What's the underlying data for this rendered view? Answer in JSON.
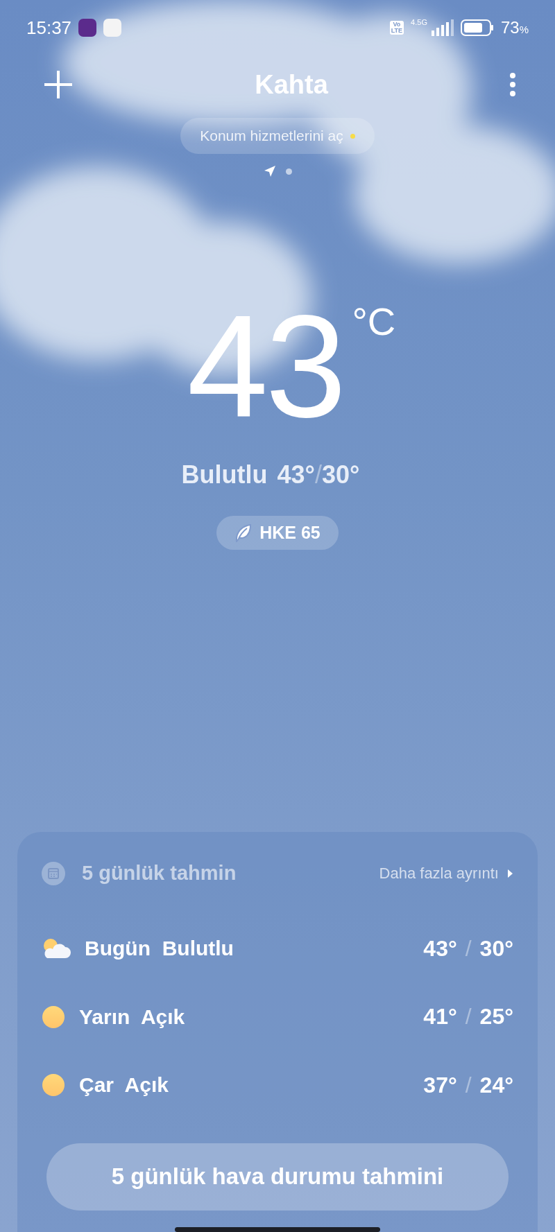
{
  "status_bar": {
    "time": "15:37",
    "volte_top": "Vo",
    "volte_bottom": "LTE",
    "network": "4.5G",
    "battery": "73",
    "battery_unit": "%"
  },
  "header": {
    "city": "Kahta",
    "location_prompt": "Konum hizmetlerini aç",
    "pages": [
      {
        "kind": "location",
        "selected": true
      },
      {
        "kind": "dot",
        "selected": false
      }
    ]
  },
  "current": {
    "temperature": "43",
    "unit": "°C",
    "condition": "Bulutlu",
    "high": "43°",
    "separator": "/",
    "low": "30°",
    "aqi": "HKE 65"
  },
  "forecast": {
    "title": "5 günlük tahmin",
    "more": "Daha fazla ayrıntı",
    "rows": [
      {
        "kind": "partly_cloudy",
        "day": "Bugün",
        "condition": "Bulutlu",
        "high": "43°",
        "separator": "/",
        "low": "30°"
      },
      {
        "kind": "sunny",
        "day": "Yarın",
        "condition": "Açık",
        "high": "41°",
        "separator": "/",
        "low": "25°"
      },
      {
        "kind": "sunny",
        "day": "Çar",
        "condition": "Açık",
        "high": "37°",
        "separator": "/",
        "low": "24°"
      }
    ],
    "button": "5 günlük hava durumu tahmini"
  }
}
